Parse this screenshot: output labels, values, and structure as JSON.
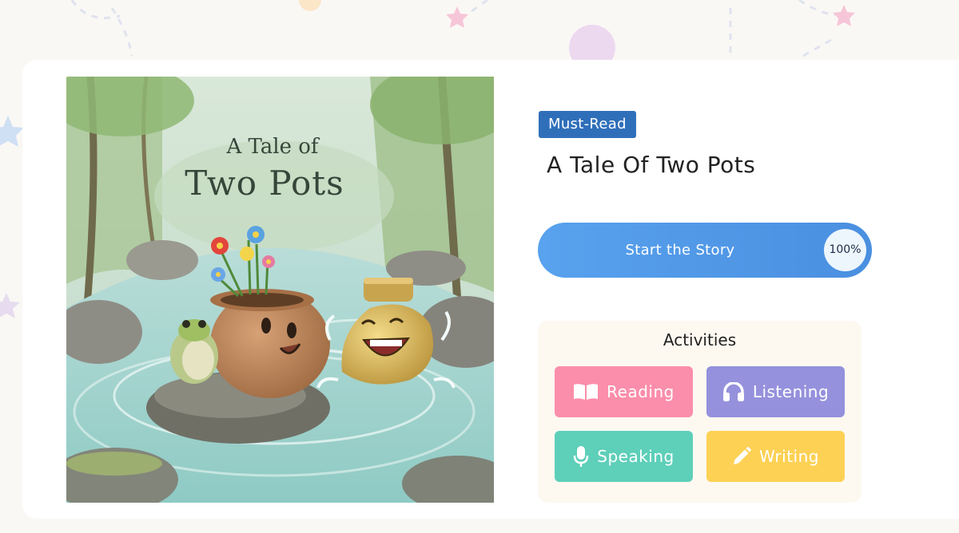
{
  "story": {
    "badge": "Must-Read",
    "title": "A Tale Of Two Pots",
    "cover_title_line1": "A Tale of",
    "cover_title_line2": "Two Pots",
    "start_label": "Start the Story",
    "progress": "100%"
  },
  "activities": {
    "title": "Activities",
    "items": [
      {
        "label": "Reading",
        "icon": "book-icon",
        "color": "#fb8eaa"
      },
      {
        "label": "Listening",
        "icon": "headphones-icon",
        "color": "#9591dc"
      },
      {
        "label": "Speaking",
        "icon": "microphone-icon",
        "color": "#5ecfb9"
      },
      {
        "label": "Writing",
        "icon": "pencil-icon",
        "color": "#fdd154"
      }
    ]
  },
  "colors": {
    "badge": "#2f6fba",
    "start_button": "#58a2ee",
    "page_background": "#faf8f5"
  }
}
